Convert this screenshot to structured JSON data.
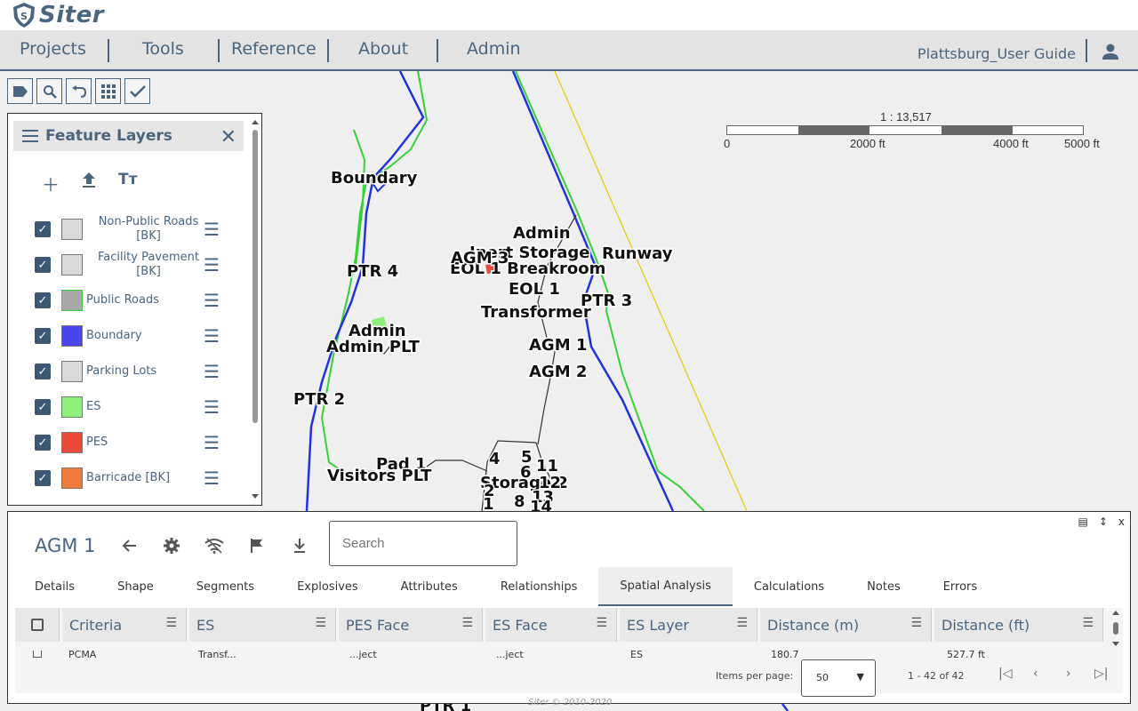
{
  "app": {
    "logo_text": "Siter",
    "project_name": "Plattsburg_User Guide",
    "footer": "Siter © 2010-2020"
  },
  "nav": {
    "items": [
      "Projects",
      "Tools",
      "Reference",
      "About",
      "Admin"
    ]
  },
  "map": {
    "scale_ratio": "1 : 13,517",
    "scale_ticks": [
      "0",
      "2000 ft",
      "4000 ft",
      "5000 ft"
    ],
    "labels": [
      "Boundary",
      "Admin",
      "Inert Storage",
      "EOL 1 Breakroom",
      "AGM 3",
      "EOL 1",
      "Runway",
      "PTR 4",
      "PTR 3",
      "Transformer",
      "Admin",
      "Admin PLT",
      "AGM 1",
      "AGM 2",
      "PTR 2",
      "Pad 1",
      "Visitors PLT",
      "Storage 2",
      "4",
      "5",
      "6",
      "11",
      "12",
      "2",
      "8",
      "13",
      "1",
      "14",
      "PTR 1"
    ]
  },
  "tools": [
    "label-icon",
    "search-icon",
    "undo-icon",
    "grid-icon",
    "check-icon"
  ],
  "layers": {
    "title": "Feature Layers",
    "items": [
      {
        "label": "Non-Public Roads [BK]",
        "color": "#d9d9d9"
      },
      {
        "label": "Facility Pavement [BK]",
        "color": "#d9d9d9"
      },
      {
        "label": "Public Roads",
        "color": "#a8a8a8"
      },
      {
        "label": "Boundary",
        "color": "#4a45ea"
      },
      {
        "label": "Parking Lots",
        "color": "#d9d9d9"
      },
      {
        "label": "ES",
        "color": "#8ef07a"
      },
      {
        "label": "PES",
        "color": "#ea4a3a"
      },
      {
        "label": "Barricade [BK]",
        "color": "#f07a3a"
      }
    ]
  },
  "detail": {
    "title": "AGM 1",
    "search_placeholder": "Search",
    "tabs": [
      "Details",
      "Shape",
      "Segments",
      "Explosives",
      "Attributes",
      "Relationships",
      "Spatial Analysis",
      "Calculations",
      "Notes",
      "Errors"
    ],
    "active_tab": "Spatial Analysis",
    "columns": [
      "Criteria",
      "ES",
      "PES Face",
      "ES Face",
      "ES Layer",
      "Distance (m)",
      "Distance (ft)"
    ],
    "row": [
      "PCMA",
      "Transf...",
      "...ject",
      "...ject",
      "ES",
      "180.7",
      "527.7 ft"
    ],
    "items_per_page_label": "Items per page:",
    "items_per_page": "50",
    "range": "1 - 42 of 42"
  }
}
